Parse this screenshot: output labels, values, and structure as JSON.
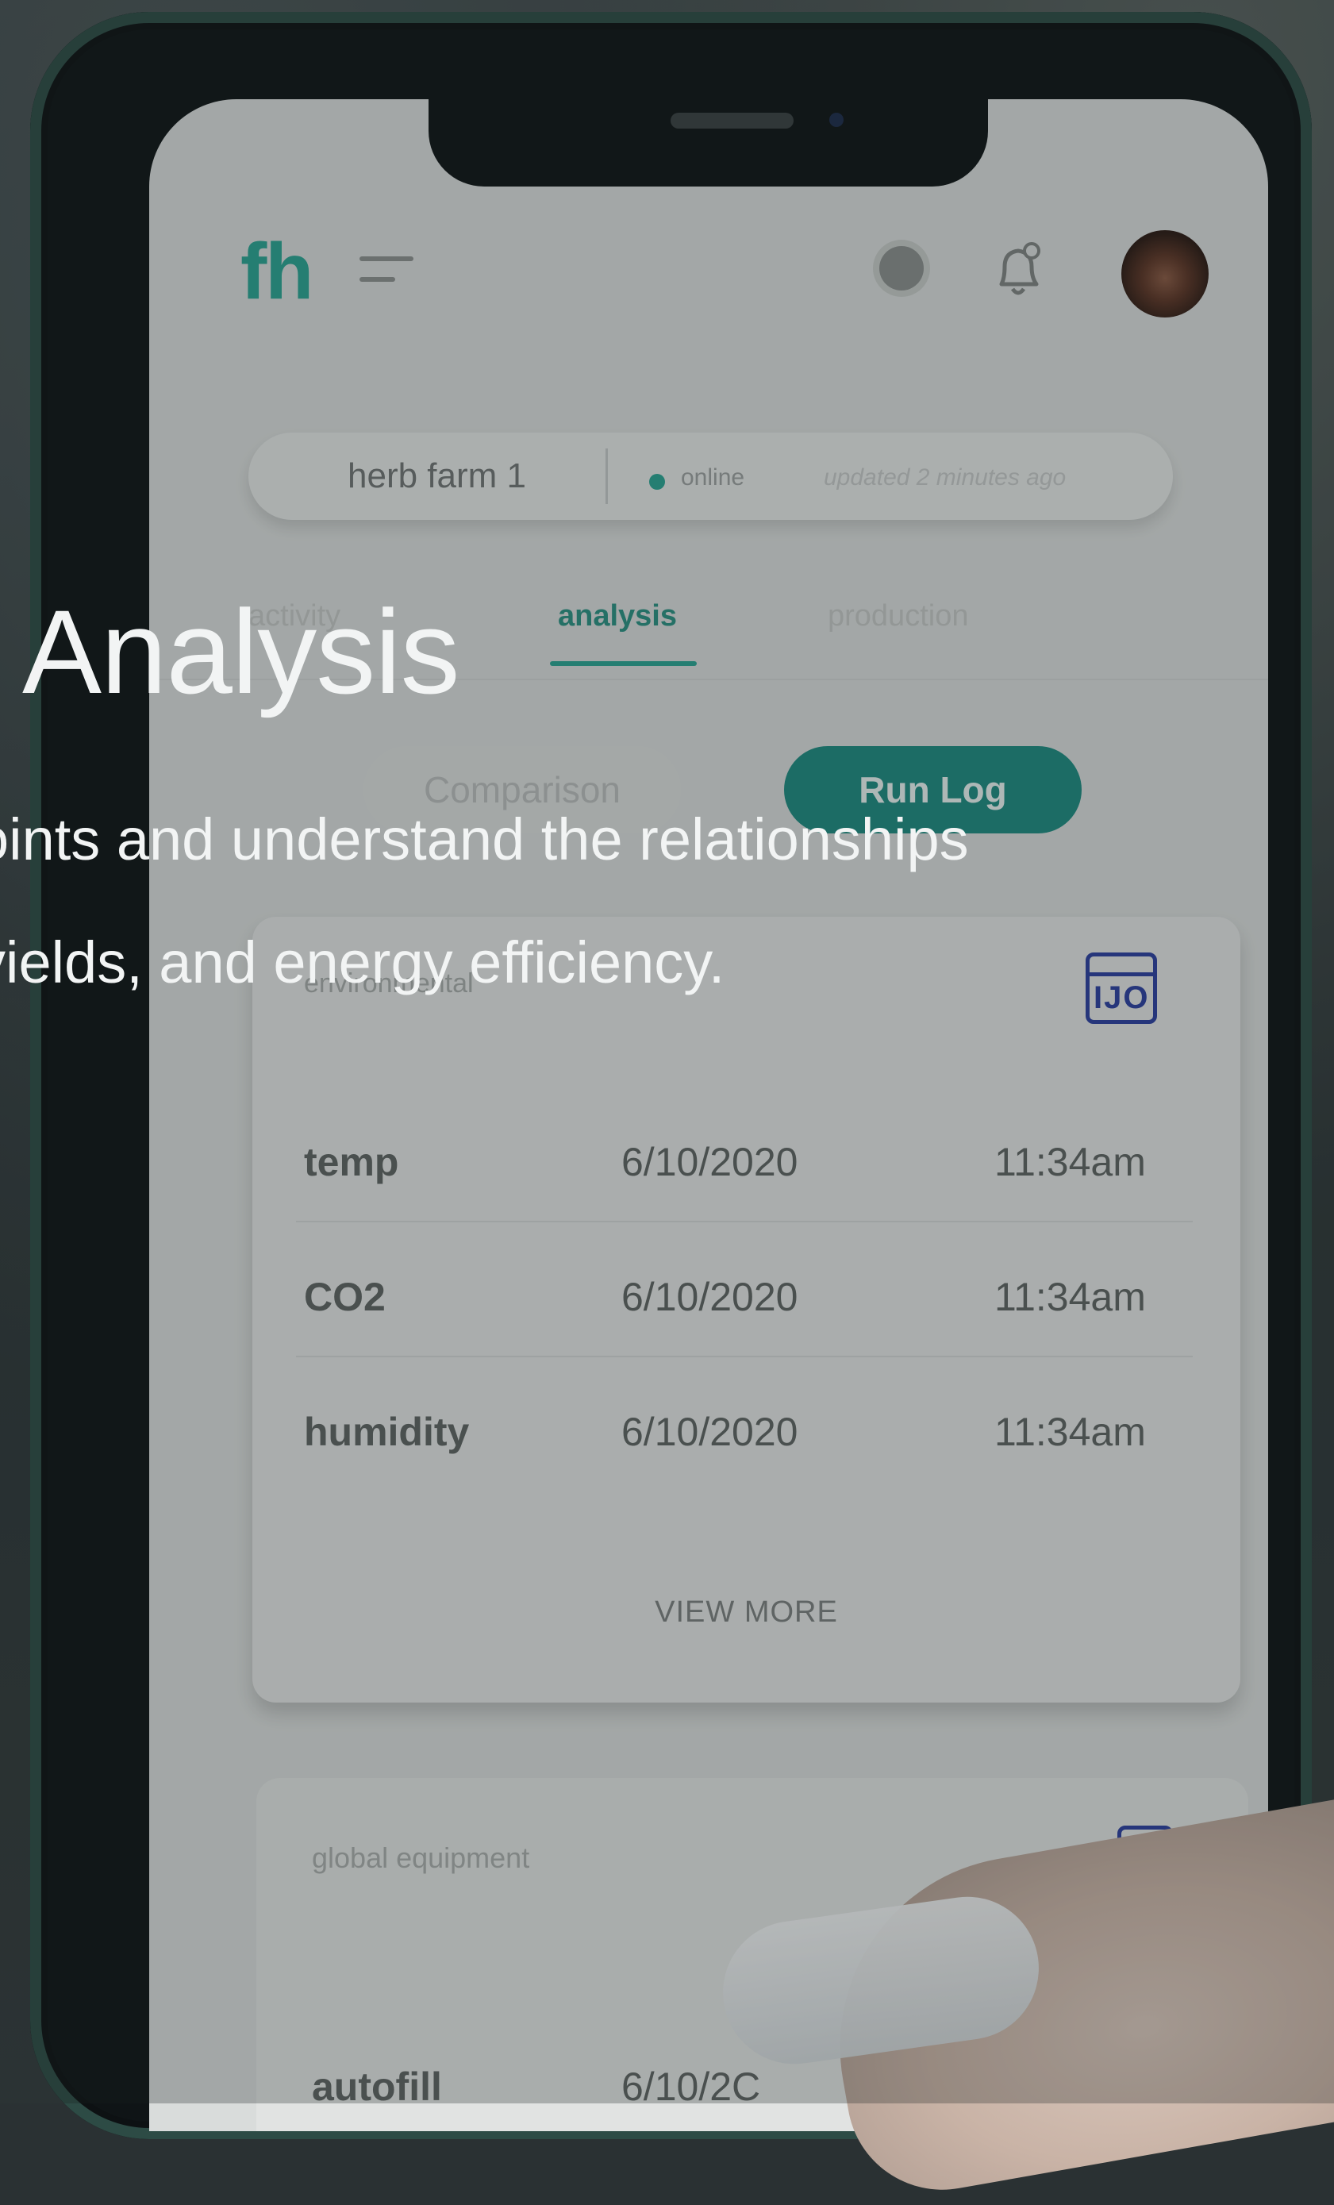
{
  "app": {
    "logo": "fh",
    "farm_name": "herb farm 1",
    "status": "online",
    "updated": "updated 2 minutes ago"
  },
  "tabs": [
    {
      "label": "activity",
      "active": false
    },
    {
      "label": "analysis",
      "active": true
    },
    {
      "label": "production",
      "active": false
    }
  ],
  "segments": {
    "comparison": "Comparison",
    "run_log": "Run Log"
  },
  "log_card": {
    "title": "environmental",
    "rows": [
      {
        "name": "temp",
        "date": "6/10/2020",
        "time": "11:34am"
      },
      {
        "name": "CO2",
        "date": "6/10/2020",
        "time": "11:34am"
      },
      {
        "name": "humidity",
        "date": "6/10/2020",
        "time": "11:34am"
      }
    ],
    "view_more": "VIEW MORE"
  },
  "equipment_card": {
    "title": "global equipment",
    "rows": [
      {
        "name": "autofill",
        "date": "6/10/2C"
      }
    ]
  },
  "hero": {
    "title": "Analysis",
    "line1": "oints and understand the relationships",
    "line2": "yields, and energy efficiency."
  },
  "colors": {
    "accent": "#2aa392",
    "active_button": "#1e8a80",
    "icon_blue": "#2b3f9e"
  }
}
